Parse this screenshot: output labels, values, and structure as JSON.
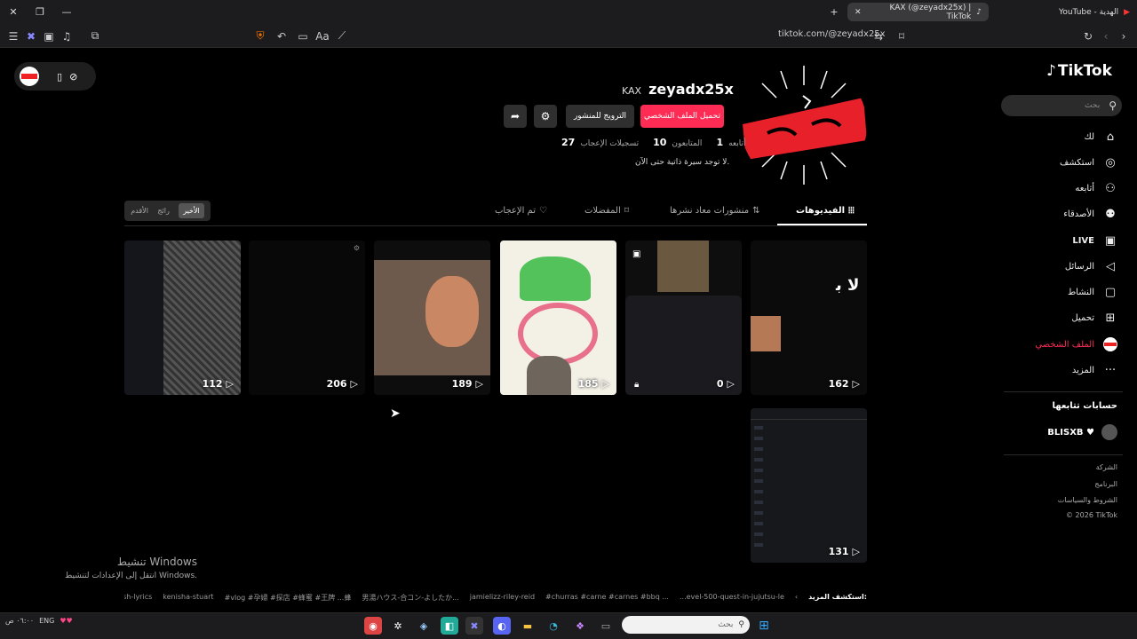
{
  "browser": {
    "tab_active_title": "KAX (@zeyadx25x) | TikTok",
    "tab_other_title": "YouTube - الهدية",
    "url": "tiktok.com/@zeyadx25x"
  },
  "sidebar": {
    "logo": "TikTok",
    "search_placeholder": "بحث",
    "items": [
      {
        "label": "لك",
        "icon": "home-icon"
      },
      {
        "label": "استكشف",
        "icon": "compass-icon"
      },
      {
        "label": "أتابعه",
        "icon": "user-follow-icon"
      },
      {
        "label": "الأصدقاء",
        "icon": "friends-icon"
      },
      {
        "label": "LIVE",
        "icon": "live-icon"
      },
      {
        "label": "الرسائل",
        "icon": "send-icon"
      },
      {
        "label": "النشاط",
        "icon": "chat-icon"
      },
      {
        "label": "تحميل",
        "icon": "plus-square-icon"
      },
      {
        "label": "الملف الشخصي",
        "icon": "avatar-icon"
      },
      {
        "label": "المزيد",
        "icon": "more-icon"
      }
    ],
    "following_title": "حسابات تتابعها",
    "following": [
      {
        "name": "BLISXB ♥"
      }
    ],
    "footer_links": [
      "الشركة",
      "البرنامج",
      "الشروط والسياسات",
      "© 2026 TikTok"
    ]
  },
  "profile": {
    "username": "zeyadx25x",
    "display_name": "KAX",
    "edit_button": "تحميل الملف الشخصي",
    "promote_button": "الترويج للمنشور",
    "following_count": "1",
    "following_label": "أتابعه",
    "followers_count": "10",
    "followers_label": "المتابعون",
    "likes_count": "27",
    "likes_label": "تسجيلات الإعجاب",
    "bio": "لا توجد سيرة ذاتية حتى الآن."
  },
  "tabs": {
    "videos": "الفيديوهات",
    "reposts": "منشورات معاد نشرها",
    "favorites": "المفضلات",
    "liked": "تم الإعجاب"
  },
  "sort": {
    "latest": "الأخير",
    "popular": "رائج",
    "oldest": "الأقدم"
  },
  "videos": [
    {
      "views": "162"
    },
    {
      "views": "0"
    },
    {
      "views": "185"
    },
    {
      "views": "189"
    },
    {
      "views": "206"
    },
    {
      "views": "112"
    },
    {
      "views": "131"
    }
  ],
  "suggestions_label": "استكشف المزيد:",
  "suggestions": [
    "...evel-500-quest-in-jujutsu-le",
    "#churras #carne #carnes #bbq ...",
    "jamielizz-riley-reid",
    "男湯ハウス-合コン-よしたか...",
    "#vlog #孕婦 #探店 #蜂蜜 #王牌 ...蜂",
    "kenisha-stuart",
    "e-ngu-mama-english-lyrics"
  ],
  "watermark": {
    "title": "تنشيط Windows",
    "subtitle": "انتقل إلى الإعدادات لتنشيط Windows."
  },
  "taskbar": {
    "search_placeholder": "بحث",
    "tray_text": "ENG",
    "time": "٠٦:٠٠ ص"
  }
}
